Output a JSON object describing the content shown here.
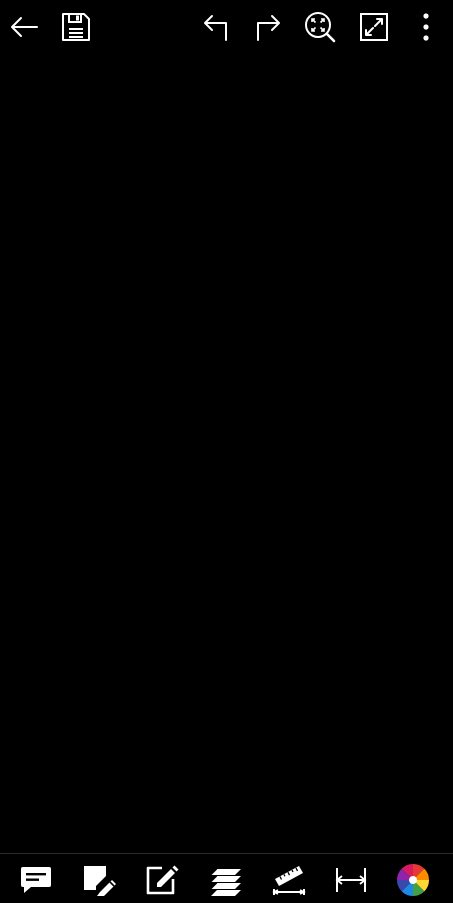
{
  "app": {
    "background_color": "#000000",
    "icon_color": "#ffffff"
  },
  "top_toolbar": {
    "icons": [
      "back-arrow-icon",
      "save-icon",
      "undo-icon",
      "redo-icon",
      "zoom-fit-icon",
      "fullscreen-icon",
      "more-vertical-icon"
    ]
  },
  "bottom_toolbar": {
    "icons": [
      "comment-icon",
      "draw-icon",
      "edit-note-icon",
      "layers-icon",
      "ruler-measure-icon",
      "dimension-icon",
      "color-wheel-icon"
    ],
    "color_wheel_colors": [
      "#e53935",
      "#fb8c00",
      "#fdd835",
      "#43a047",
      "#1e88e5",
      "#3949ab",
      "#8e24aa",
      "#d81b60"
    ]
  }
}
